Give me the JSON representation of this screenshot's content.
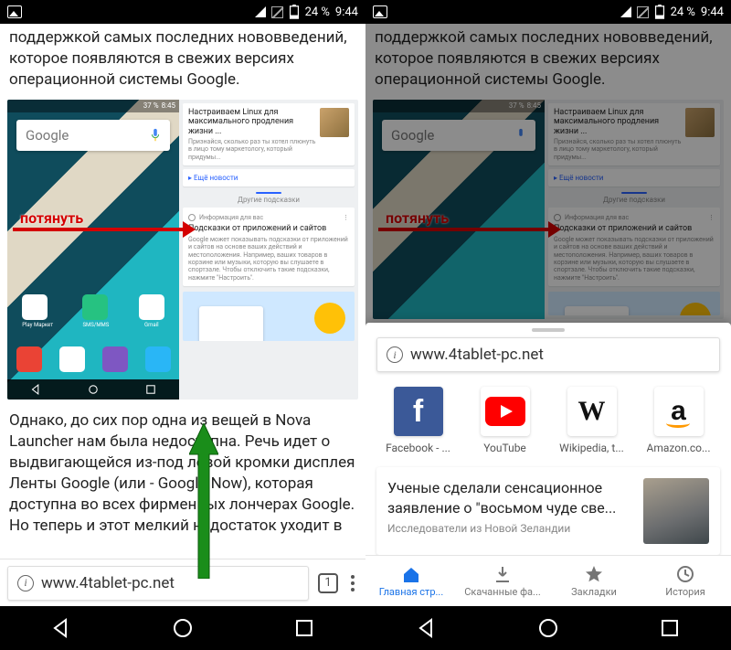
{
  "status": {
    "battery_pct": "24 %",
    "time": "9:44",
    "mini_battery": "37 %",
    "mini_time": "8:45"
  },
  "article": {
    "top_text": "поддержкой самых последних нововведений, которое появляются в свежих версиях операционной системы Google.",
    "mid_text": "Однако, до сих пор одна из вещей в Nova Launcher нам была недоступна. Речь идет о выдвигающейся из-под левой кромки дисплея Ленты Google (или - Google Now), которая доступна во всех фирменных лончерах Google. Но теперь и этот мелкий недостаток уходит в"
  },
  "composite": {
    "search_placeholder": "Google",
    "pull_label": "потянуть",
    "apps_top": [
      {
        "label": "Play Маркет",
        "bg": "#fff"
      },
      {
        "label": "SMS/MMS",
        "bg": "#26c281"
      },
      {
        "label": "Gmail",
        "bg": "#fff"
      }
    ],
    "apps_bot": [
      {
        "bg": "#ea4335"
      },
      {
        "bg": "#fff"
      },
      {
        "bg": "#7e57c2"
      },
      {
        "bg": "#29b6f6"
      }
    ],
    "cards": {
      "linux_title": "Настраиваем Linux для максимального продления жизни ...",
      "linux_sub": "Признайся, сколько раз ты хотел плюнуть в лицо тому маркетологу, который придумы...",
      "more_news": "Ещё новости",
      "other_hints": "Другие подсказки",
      "info_header": "Информация для вас",
      "hints_title": "Подсказки от приложений и сайтов",
      "hints_sub": "Google может показывать подсказки от приложений и сайтов на основе ваших действий и местоположения. Например, ваших товаров в корзине или музыки, которую вы слушаете в спортзале. Чтобы отключить такие подсказки, нажмите \"Настроить\"."
    }
  },
  "chrome": {
    "url": "www.4tablet-pc.net",
    "tab_count": "1"
  },
  "sheet": {
    "sites": [
      {
        "label": "Facebook - ...",
        "kind": "fb",
        "glyph": "f"
      },
      {
        "label": "YouTube",
        "kind": "yt",
        "glyph": ""
      },
      {
        "label": "Wikipedia, t...",
        "kind": "wk",
        "glyph": "W"
      },
      {
        "label": "Amazon.co...",
        "kind": "am",
        "glyph": "a"
      }
    ],
    "news": {
      "title": "Ученые сделали сенсационное заявление о \"восьмом чуде све...",
      "source": "Исследователи из Новой Зеландии"
    },
    "tabs": [
      {
        "label": "Главная стр...",
        "icon": "home",
        "active": true
      },
      {
        "label": "Скачанные фа...",
        "icon": "download",
        "active": false
      },
      {
        "label": "Закладки",
        "icon": "star",
        "active": false
      },
      {
        "label": "История",
        "icon": "history",
        "active": false
      }
    ]
  }
}
